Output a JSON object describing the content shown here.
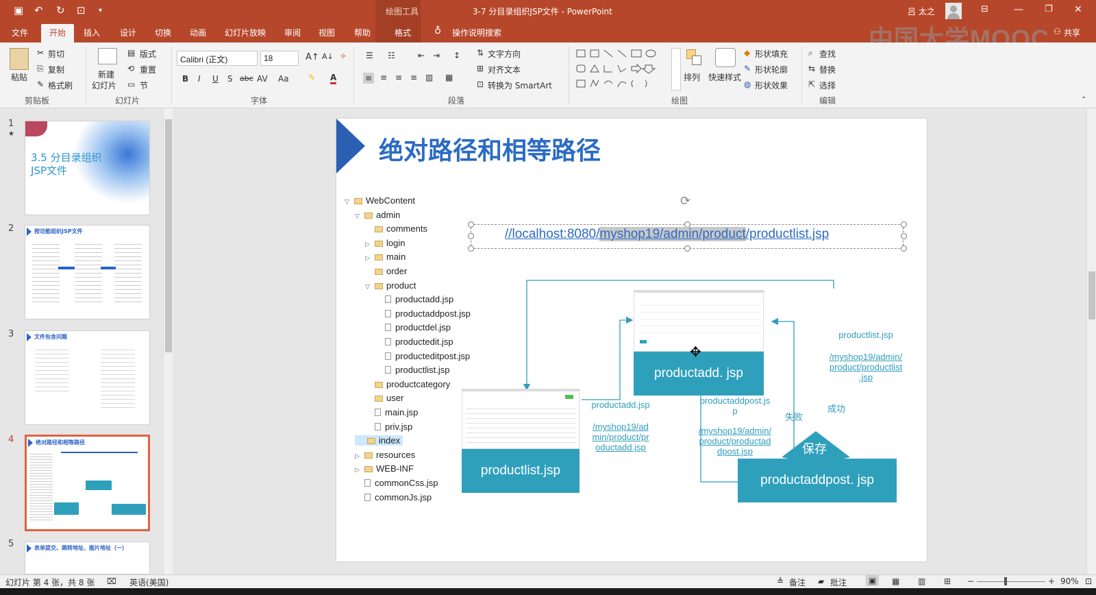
{
  "window": {
    "context_tab": "绘图工具",
    "title": "3-7 分目录组织JSP文件 - PowerPoint",
    "user": "吕 太之",
    "watermark": "中国大学MOOC",
    "share": "共享"
  },
  "tabs": [
    "文件",
    "开始",
    "插入",
    "设计",
    "切换",
    "动画",
    "幻灯片放映",
    "审阅",
    "视图",
    "帮助",
    "格式"
  ],
  "tell_me": "操作说明搜索",
  "ribbon": {
    "clipboard": {
      "paste": "粘贴",
      "cut": "剪切",
      "copy": "复制",
      "format_painter": "格式刷",
      "group": "剪贴板"
    },
    "slides": {
      "new_slide": "新建",
      "new_slide2": "幻灯片",
      "layout": "版式",
      "reset": "重置",
      "section": "节",
      "group": "幻灯片"
    },
    "font": {
      "name": "Calibri (正文)",
      "size": "18",
      "group": "字体"
    },
    "paragraph": {
      "text_direction": "文字方向",
      "align_text": "对齐文本",
      "smartart": "转换为 SmartArt",
      "group": "段落"
    },
    "drawing": {
      "arrange": "排列",
      "quick_styles": "快速样式",
      "fill": "形状填充",
      "outline": "形状轮廓",
      "effects": "形状效果",
      "group": "绘图"
    },
    "editing": {
      "find": "查找",
      "replace": "替换",
      "select": "选择",
      "group": "编辑"
    }
  },
  "thumbnails": [
    {
      "num": "1",
      "title": "3.5 分目录组织\nJSP文件"
    },
    {
      "num": "2",
      "title": "按功能组织JSP文件"
    },
    {
      "num": "3",
      "title": "文件包含问题"
    },
    {
      "num": "4",
      "title": "绝对路径和相等路径"
    },
    {
      "num": "5",
      "title": "表单提交、跳转地址、图片地址（一）"
    }
  ],
  "slide": {
    "title": "绝对路径和相等路径",
    "url_prefix": "//localhost:8080/",
    "url_highlight": "myshop19/admin/product",
    "url_suffix": "/productlist.jsp",
    "tree": [
      {
        "label": "WebContent",
        "level": 0,
        "type": "folder",
        "arrow": "open"
      },
      {
        "label": "admin",
        "level": 1,
        "type": "folder",
        "arrow": "open"
      },
      {
        "label": "comments",
        "level": 2,
        "type": "folder",
        "arrow": ""
      },
      {
        "label": "login",
        "level": 2,
        "type": "folder",
        "arrow": "closed"
      },
      {
        "label": "main",
        "level": 2,
        "type": "folder",
        "arrow": "closed"
      },
      {
        "label": "order",
        "level": 2,
        "type": "folder",
        "arrow": ""
      },
      {
        "label": "product",
        "level": 2,
        "type": "folder",
        "arrow": "open"
      },
      {
        "label": "productadd.jsp",
        "level": 3,
        "type": "file",
        "arrow": ""
      },
      {
        "label": "productaddpost.jsp",
        "level": 3,
        "type": "file",
        "arrow": ""
      },
      {
        "label": "productdel.jsp",
        "level": 3,
        "type": "file",
        "arrow": ""
      },
      {
        "label": "productedit.jsp",
        "level": 3,
        "type": "file",
        "arrow": ""
      },
      {
        "label": "producteditpost.jsp",
        "level": 3,
        "type": "file",
        "arrow": ""
      },
      {
        "label": "productlist.jsp",
        "level": 3,
        "type": "file",
        "arrow": ""
      },
      {
        "label": "productcategory",
        "level": 2,
        "type": "folder",
        "arrow": ""
      },
      {
        "label": "user",
        "level": 2,
        "type": "folder",
        "arrow": ""
      },
      {
        "label": "main.jsp",
        "level": 2,
        "type": "file",
        "arrow": ""
      },
      {
        "label": "priv.jsp",
        "level": 2,
        "type": "file",
        "arrow": ""
      },
      {
        "label": "index",
        "level": 1,
        "type": "folder",
        "arrow": "",
        "selected": true
      },
      {
        "label": "resources",
        "level": 1,
        "type": "folder",
        "arrow": "closed"
      },
      {
        "label": "WEB-INF",
        "level": 1,
        "type": "folder",
        "arrow": "closed"
      },
      {
        "label": "commonCss.jsp",
        "level": 1,
        "type": "file",
        "arrow": ""
      },
      {
        "label": "commonJs.jsp",
        "level": 1,
        "type": "file",
        "arrow": ""
      }
    ],
    "box_productadd": "productadd. jsp",
    "box_productlist": "productlist.jsp",
    "box_productaddpost": "productaddpost. jsp",
    "diamond": "保存",
    "lbl_productadd": "productadd.jsp",
    "lbl_productadd_url": "/myshop19/ad\nmin/product/pr\noductadd.jsp",
    "lbl_addpost": "productaddpost.js\np",
    "lbl_addpost_url": "/myshop19/admin/\nproduct/productad\ndpost.jsp",
    "lbl_fail": "失败",
    "lbl_success": "成功",
    "lbl_list": "productlist.jsp",
    "lbl_list_url": "/myshop19/admin/\nproduct/productlist\n.jsp"
  },
  "status": {
    "slide_info": "幻灯片 第 4 张，共 8 张",
    "language": "英语(美国)",
    "notes": "备注",
    "comments": "批注",
    "zoom": "90%"
  }
}
